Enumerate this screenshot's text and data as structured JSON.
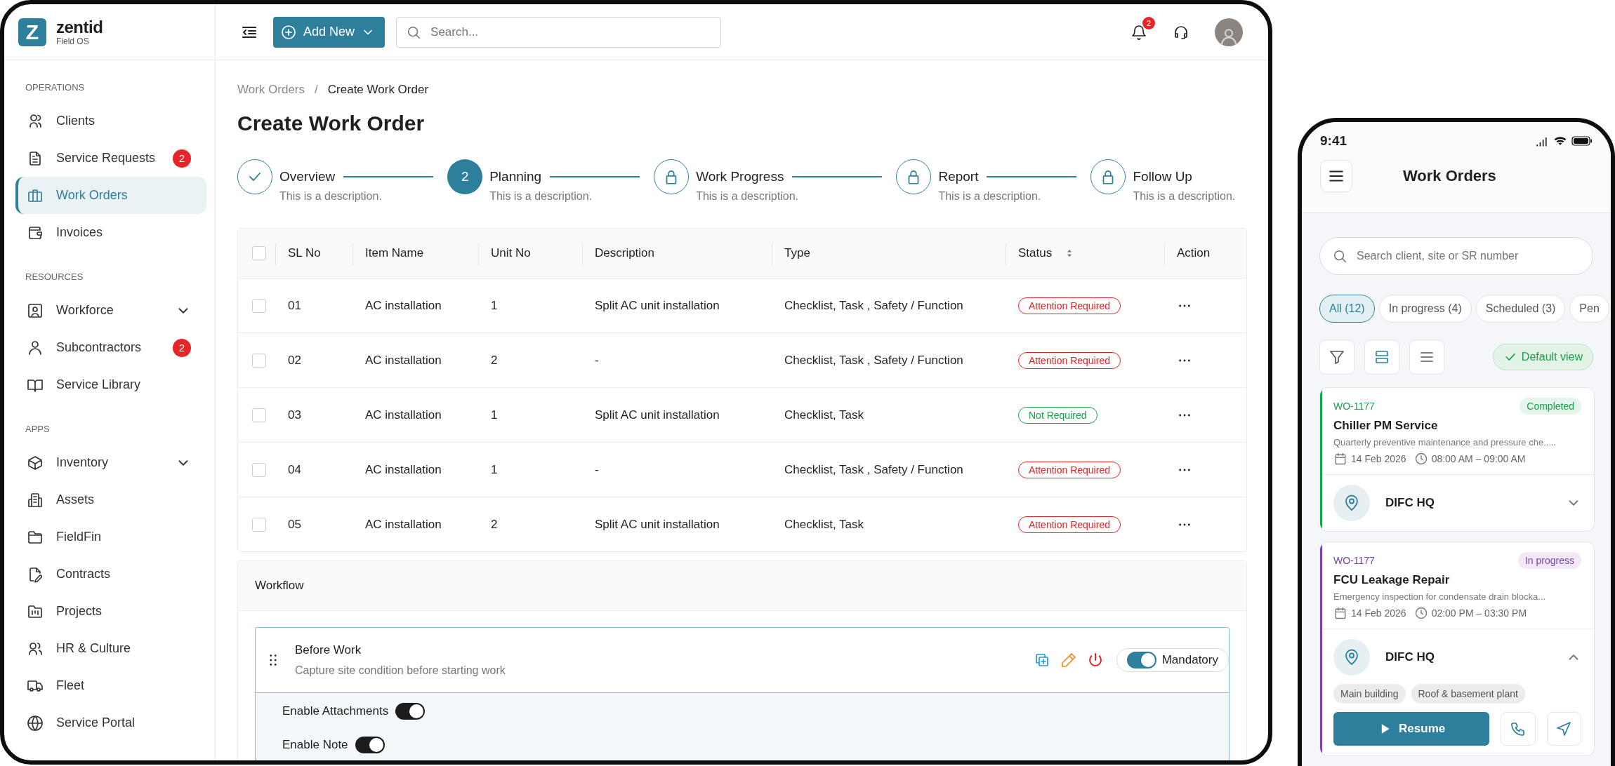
{
  "sidebar": {
    "logo": {
      "mark": "Z",
      "name": "zentid",
      "tagline": "Field OS"
    },
    "sections": [
      {
        "title": "OPERATIONS",
        "items": [
          {
            "label": "Clients",
            "selected": false
          },
          {
            "label": "Service Requests",
            "selected": false,
            "badge": "2"
          },
          {
            "label": "Work Orders",
            "selected": true
          },
          {
            "label": "Invoices",
            "selected": false
          }
        ]
      },
      {
        "title": "RESOURCES",
        "items": [
          {
            "label": "Workforce",
            "selected": false,
            "expanded": false
          },
          {
            "label": "Subcontractors",
            "selected": false,
            "badge": "2"
          },
          {
            "label": "Service Library",
            "selected": false
          }
        ]
      },
      {
        "title": "APPS",
        "items": [
          {
            "label": "Inventory",
            "selected": false,
            "expanded": false
          },
          {
            "label": "Assets",
            "selected": false
          },
          {
            "label": "FieldFin",
            "selected": false
          },
          {
            "label": "Contracts",
            "selected": false
          },
          {
            "label": "Projects",
            "selected": false
          },
          {
            "label": "HR & Culture",
            "selected": false
          },
          {
            "label": "Fleet",
            "selected": false
          },
          {
            "label": "Service Portal",
            "selected": false
          }
        ]
      }
    ]
  },
  "topbar": {
    "add_button": "Add New",
    "search": {
      "placeholder": "Search..."
    },
    "notifications": "2"
  },
  "breadcrumb": {
    "items": [
      "Work Orders",
      "Create Work Order"
    ],
    "separator": "/"
  },
  "title": "Create Work Order",
  "steps": [
    {
      "label": "Overview",
      "description": "This is a description.",
      "kind": "done"
    },
    {
      "label": "Planning",
      "description": "This is a description.",
      "kind": "current",
      "number": "2"
    },
    {
      "label": "Work Progress",
      "description": "This is a description.",
      "kind": "locked"
    },
    {
      "label": "Report",
      "description": "This is a description.",
      "kind": "locked"
    },
    {
      "label": "Follow Up",
      "description": "This is a description.",
      "kind": "locked"
    }
  ],
  "table": {
    "all_checked": false,
    "columns": [
      "SL No",
      "Item Name",
      "Unit No",
      "Description",
      "Type",
      "Status",
      "Action"
    ],
    "rows": [
      {
        "checked": false,
        "sl_no": "01",
        "item_name": "AC installation",
        "unit_no": "1",
        "description": "Split AC unit installation",
        "type": "Checklist, Task , Safety / Function",
        "status": {
          "label": "Attention Required",
          "kind": "attention"
        }
      },
      {
        "checked": false,
        "sl_no": "02",
        "item_name": "AC installation",
        "unit_no": "2",
        "description": "-",
        "type": "Checklist, Task , Safety / Function",
        "status": {
          "label": "Attention Required",
          "kind": "attention"
        }
      },
      {
        "checked": false,
        "sl_no": "03",
        "item_name": "AC installation",
        "unit_no": "1",
        "description": "Split AC unit installation",
        "type": "Checklist, Task",
        "status": {
          "label": "Not Required",
          "kind": "ok"
        }
      },
      {
        "checked": false,
        "sl_no": "04",
        "item_name": "AC installation",
        "unit_no": "1",
        "description": "-",
        "type": "Checklist, Task , Safety / Function",
        "status": {
          "label": "Attention Required",
          "kind": "attention"
        }
      },
      {
        "checked": false,
        "sl_no": "05",
        "item_name": "AC installation",
        "unit_no": "2",
        "description": "Split AC unit installation",
        "type": "Checklist, Task",
        "status": {
          "label": "Attention Required",
          "kind": "attention"
        }
      }
    ]
  },
  "workflow": {
    "title": "Workflow",
    "stages": [
      {
        "title": "Before Work",
        "description": "Capture site condition before starting work",
        "mandatory": {
          "label": "Mandatory",
          "on": true
        },
        "options": [
          {
            "label": "Enable Attachments",
            "on": true
          },
          {
            "label": "Enable Note",
            "on": true
          }
        ]
      }
    ]
  },
  "phone": {
    "time": "9:41",
    "title": "Work Orders",
    "search": {
      "placeholder": "Search client, site or SR number"
    },
    "filters": [
      {
        "label": "All (12)",
        "selected": true
      },
      {
        "label": "In progress (4)",
        "selected": false
      },
      {
        "label": "Scheduled (3)",
        "selected": false
      },
      {
        "label": "Pen",
        "selected": false
      }
    ],
    "view_buttons": [
      {
        "kind": "filter",
        "selected": false
      },
      {
        "kind": "cards",
        "selected": true
      },
      {
        "kind": "list",
        "selected": false
      }
    ],
    "default_view": "Default view",
    "cards": [
      {
        "id": "WO-1177",
        "status": "Completed",
        "color": "#16a34a",
        "title": "Chiller PM Service",
        "description": "Quarterly preventive maintenance and pressure che.....",
        "date": "14 Feb 2026",
        "time": "08:00 AM – 09:00 AM",
        "location": "DIFC HQ",
        "expanded": false
      },
      {
        "id": "WO-1177",
        "status": "In progress",
        "color": "#7e3fae",
        "title": "FCU Leakage Repair",
        "description": "Emergency inspection for condensate drain blocka...",
        "date": "14 Feb 2026",
        "time": "02:00 PM – 03:30 PM",
        "location": "DIFC HQ",
        "expanded": true,
        "tags": [
          "Main building",
          "Roof & basement plant"
        ],
        "action": "Resume"
      }
    ]
  }
}
